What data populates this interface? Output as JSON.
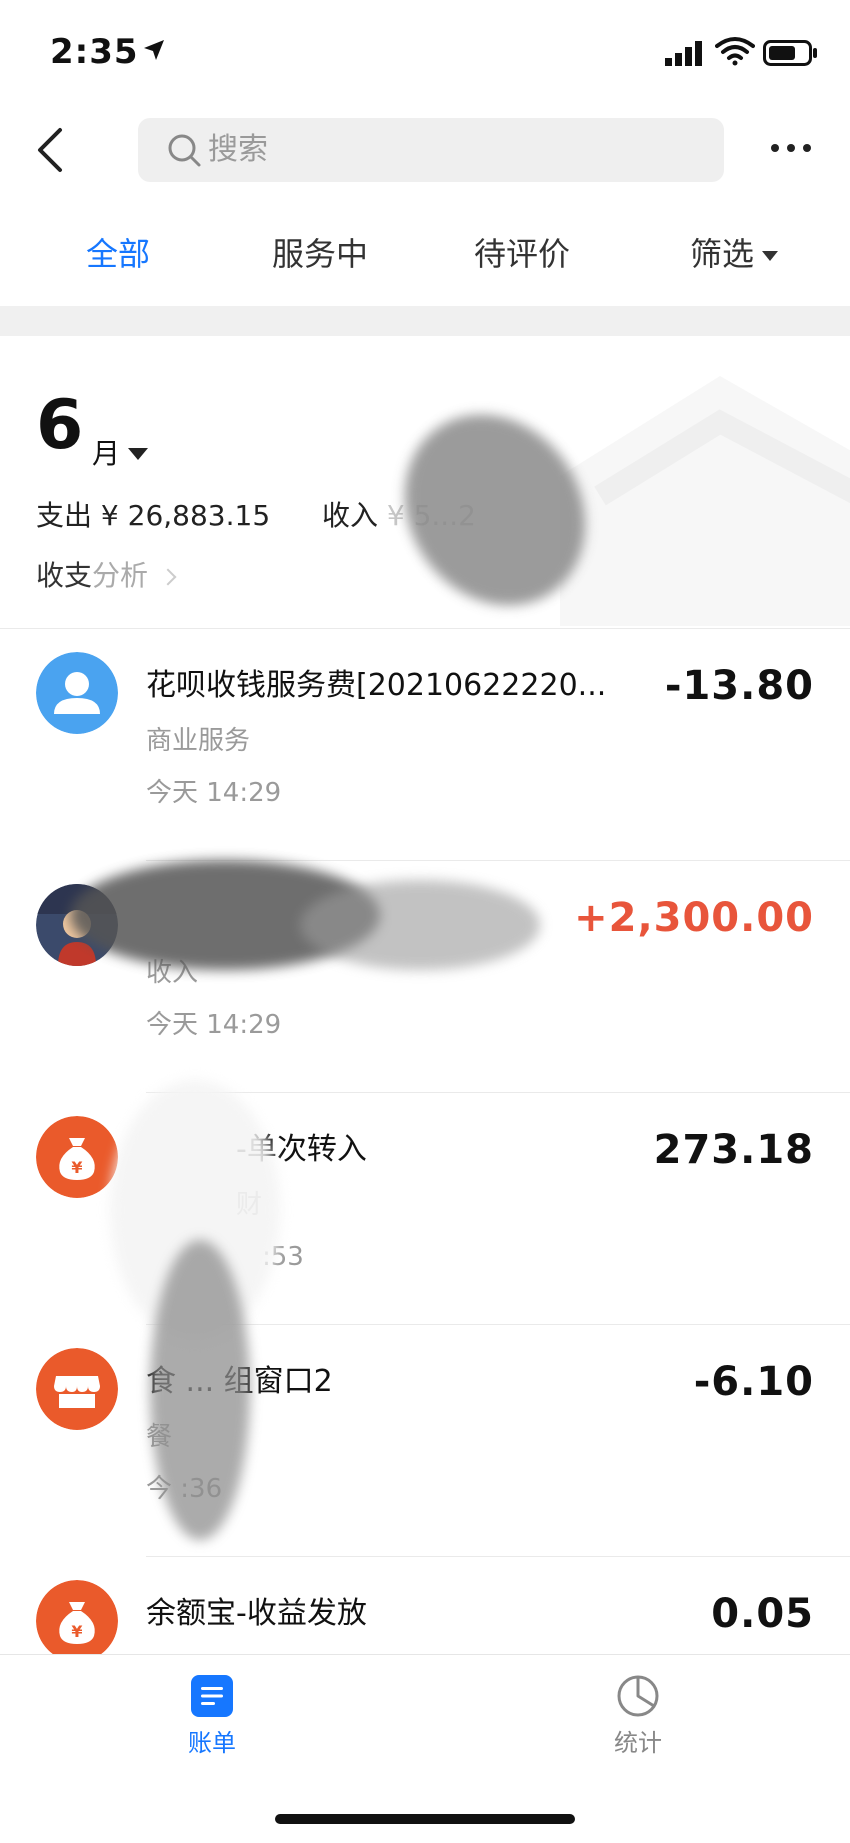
{
  "status_bar": {
    "time": "2:35",
    "icons": [
      "location-arrow-icon",
      "signal-bars-icon",
      "wifi-icon",
      "battery-icon"
    ]
  },
  "nav": {
    "back_icon": "chevron-left-icon",
    "search_placeholder": "搜索",
    "more_icon": "more-dots-icon"
  },
  "tabs": [
    {
      "label": "全部",
      "active": true
    },
    {
      "label": "服务中",
      "active": false
    },
    {
      "label": "待评价",
      "active": false
    },
    {
      "label": "筛选",
      "active": false
    }
  ],
  "month": {
    "number": "6",
    "unit": "月",
    "expense_label": "支出",
    "expense_value": "¥ 26,883.15",
    "income_label": "收入",
    "income_value": "¥ 5...2",
    "analysis_label": "收支",
    "analysis_sub": "分析"
  },
  "transactions": [
    {
      "icon": "person-avatar-icon",
      "title": "花呗收钱服务费[20210622220...",
      "amount": "-13.80",
      "type": "expense",
      "category": "商业服务",
      "time": "今天  14:29"
    },
    {
      "icon": "photo-avatar",
      "title": "",
      "amount": "+2,300.00",
      "type": "income",
      "category": "收入",
      "time": "今天  14:29"
    },
    {
      "icon": "money-bag-icon",
      "title": "-单次转入",
      "amount": "273.18",
      "type": "expense",
      "category": "财",
      "time": ":53"
    },
    {
      "icon": "shop-icon",
      "title": "食 ... 组窗口2",
      "amount": "-6.10",
      "type": "expense",
      "category": "餐",
      "time": "今 :36"
    },
    {
      "icon": "money-bag-icon",
      "title": "余额宝-收益发放",
      "amount": "0.05",
      "type": "expense",
      "category": "",
      "time": ""
    }
  ],
  "tabbar": [
    {
      "label": "账单",
      "icon": "bill-list-icon",
      "active": true
    },
    {
      "label": "统计",
      "icon": "pie-chart-icon",
      "active": false
    }
  ],
  "colors": {
    "accent": "#1677ff",
    "income": "#e8553b",
    "expense": "#111111",
    "icon_blue": "#4aa3f0",
    "icon_orange": "#ea5a2b"
  }
}
